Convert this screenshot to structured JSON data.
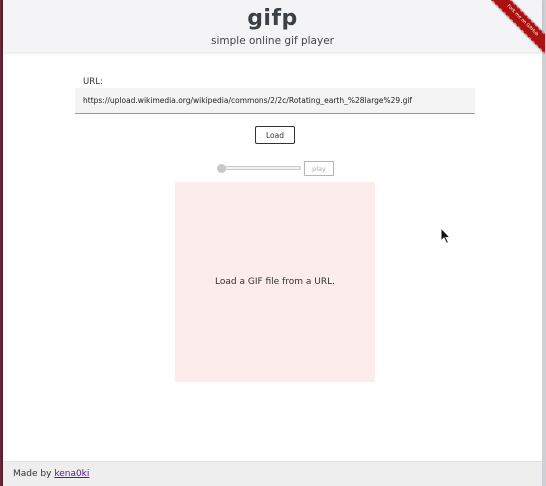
{
  "header": {
    "title": "gifp",
    "subtitle": "simple online gif player",
    "ribbon_label": "Fork me on GitHub"
  },
  "form": {
    "url_label": "URL:",
    "url_value": "https://upload.wikimedia.org/wikipedia/commons/2/2c/Rotating_earth_%28large%29.gif",
    "load_label": "Load"
  },
  "player": {
    "play_label": "play",
    "frame_position": 0,
    "message": "Load a GIF file from a URL.",
    "placeholder_color": "#fdecec"
  },
  "footer": {
    "made_by": "Made by",
    "author": "kena0ki"
  }
}
